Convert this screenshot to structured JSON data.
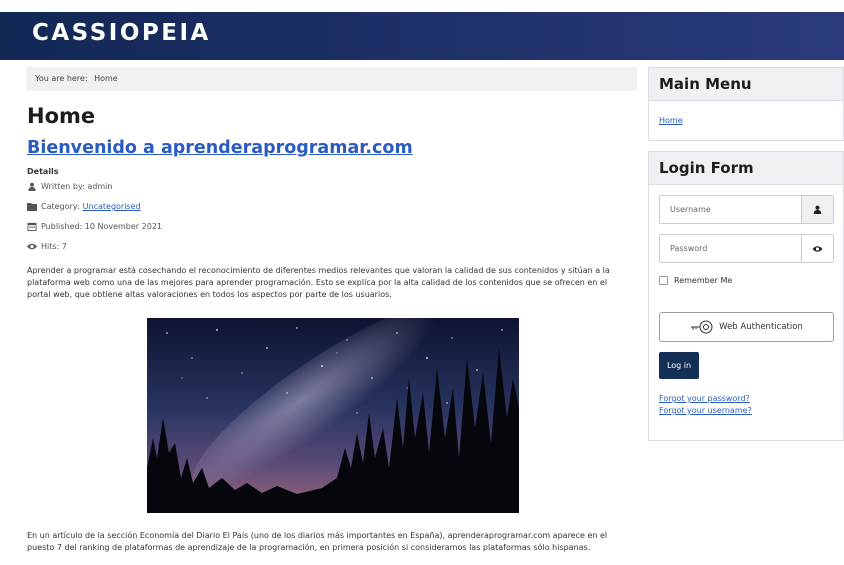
{
  "site": {
    "brand": "CASSIOPEIA"
  },
  "breadcrumb": {
    "prefix": "You are here:",
    "current": "Home"
  },
  "page": {
    "title": "Home"
  },
  "article": {
    "title": "Bienvenido a aprenderaprogramar.com",
    "details_label": "Details",
    "written_by": "Written by: admin",
    "category_label": "Category:",
    "category_link": "Uncategorised",
    "published": "Published: 10 November 2021",
    "hits": "Hits: 7",
    "paragraph1": "Aprender a programar está cosechando el reconocimiento de diferentes medios relevantes que valoran la calidad de sus contenidos y sitúan a la plataforma web como una de las mejores para aprender programación. Esto se explica por la alta calidad de los contenidos que se ofrecen en el portal web, que obtiene altas valoraciones en todos los aspectos por parte de los usuarios.",
    "paragraph2": "En un artículo de la sección Economía del Diario El País (uno de los diarios más importantes en España), aprenderaprogramar.com aparece en el puesto 7 del ranking de plataformas de aprendizaje de la programación, en primera posición si consideramos las plataformas sólo hispanas."
  },
  "main_menu": {
    "title": "Main Menu",
    "items": [
      "Home"
    ]
  },
  "login_form": {
    "title": "Login Form",
    "username_placeholder": "Username",
    "password_placeholder": "Password",
    "remember_label": "Remember Me",
    "webauthn_label": "Web Authentication",
    "login_button": "Log in",
    "forgot_password": "Forgot your password?",
    "forgot_username": "Forgot your username?"
  },
  "colors": {
    "header_start": "#112855",
    "header_end": "#2a3a7c",
    "link": "#2a5bbf",
    "button": "#132f55"
  },
  "icons": [
    "user-icon",
    "folder-icon",
    "calendar-icon",
    "eye-icon",
    "key-icon"
  ]
}
